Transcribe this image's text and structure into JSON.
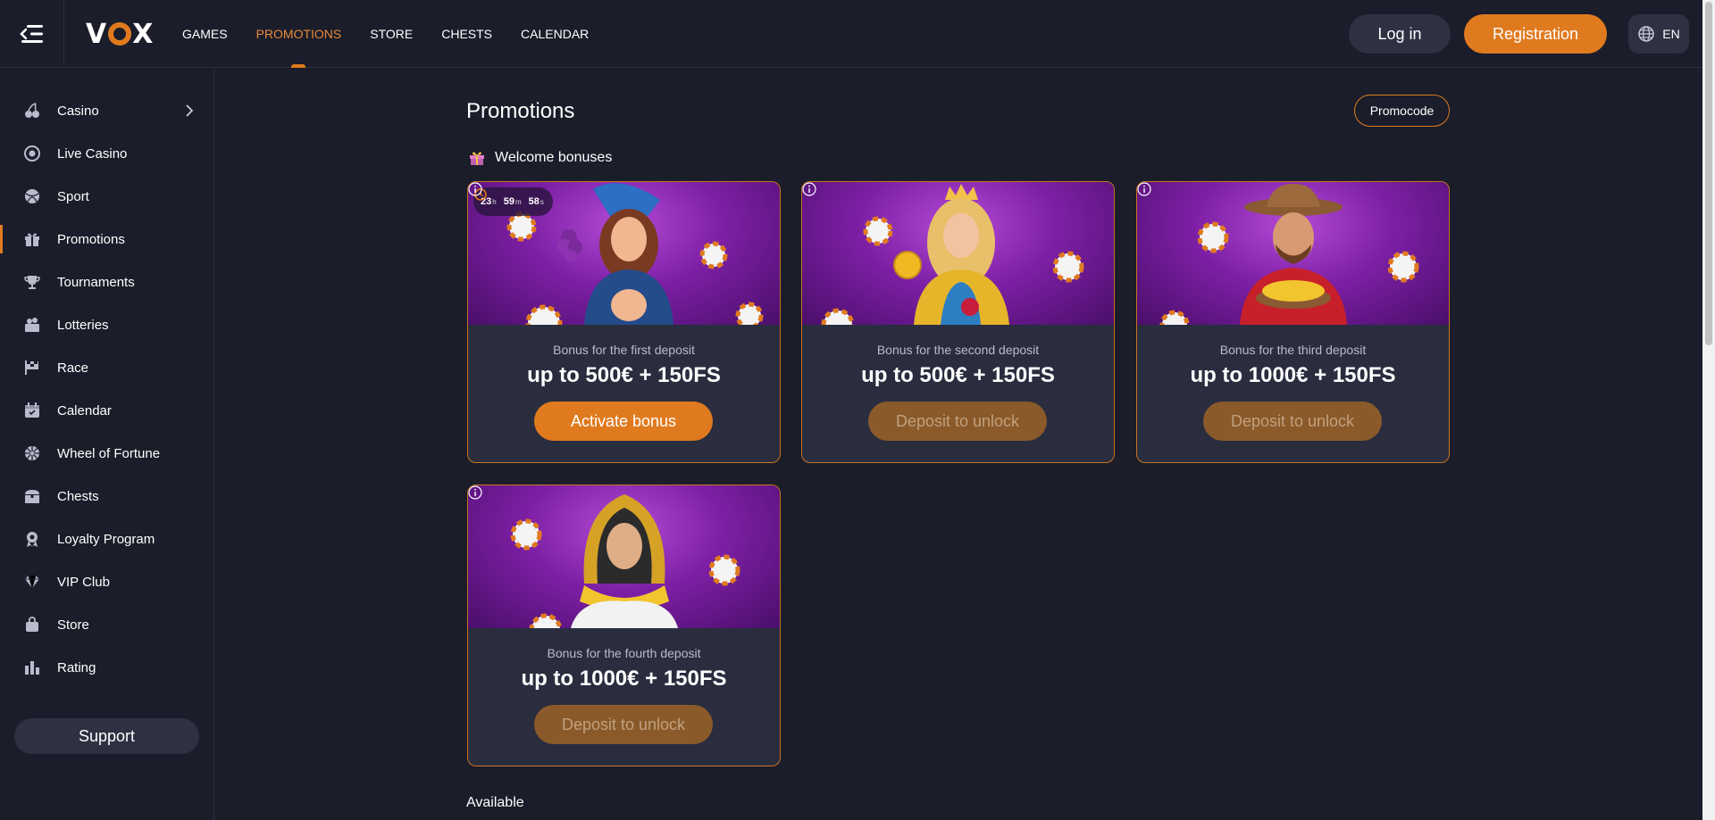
{
  "header": {
    "logo": "VOX",
    "nav": [
      "GAMES",
      "PROMOTIONS",
      "STORE",
      "CHESTS",
      "CALENDAR"
    ],
    "login": "Log in",
    "registration": "Registration",
    "language": "EN"
  },
  "sidebar": {
    "items": [
      {
        "label": "Casino",
        "icon": "cherries-icon"
      },
      {
        "label": "Live Casino",
        "icon": "roulette-icon"
      },
      {
        "label": "Sport",
        "icon": "ball-icon"
      },
      {
        "label": "Promotions",
        "icon": "gift-icon"
      },
      {
        "label": "Tournaments",
        "icon": "trophy-icon"
      },
      {
        "label": "Lotteries",
        "icon": "lottery-icon"
      },
      {
        "label": "Race",
        "icon": "flag-icon"
      },
      {
        "label": "Calendar",
        "icon": "calendar-icon"
      },
      {
        "label": "Wheel of Fortune",
        "icon": "wheel-icon"
      },
      {
        "label": "Chests",
        "icon": "chest-icon"
      },
      {
        "label": "Loyalty Program",
        "icon": "medal-icon"
      },
      {
        "label": "VIP Club",
        "icon": "diamond-icon"
      },
      {
        "label": "Store",
        "icon": "bag-icon"
      },
      {
        "label": "Rating",
        "icon": "chart-icon"
      }
    ],
    "support": "Support"
  },
  "main": {
    "title": "Promotions",
    "promocode": "Promocode",
    "section_title": "Welcome bonuses",
    "timer": {
      "hours": "23",
      "h": "h",
      "minutes": "59",
      "m": "m",
      "seconds": "58",
      "s": "s"
    },
    "cards": [
      {
        "subtitle": "Bonus for the first deposit",
        "amount": "up to 500€ + 150FS",
        "button": "Activate bonus"
      },
      {
        "subtitle": "Bonus for the second deposit",
        "amount": "up to 500€ + 150FS",
        "button": "Deposit to unlock"
      },
      {
        "subtitle": "Bonus for the third deposit",
        "amount": "up to 1000€ + 150FS",
        "button": "Deposit to unlock"
      },
      {
        "subtitle": "Bonus for the fourth deposit",
        "amount": "up to 1000€ + 150FS",
        "button": "Deposit to unlock"
      }
    ],
    "available": "Available"
  },
  "colors": {
    "accent": "#e07a1f",
    "background": "#1b1d2a",
    "card": "#2a2d3e"
  }
}
